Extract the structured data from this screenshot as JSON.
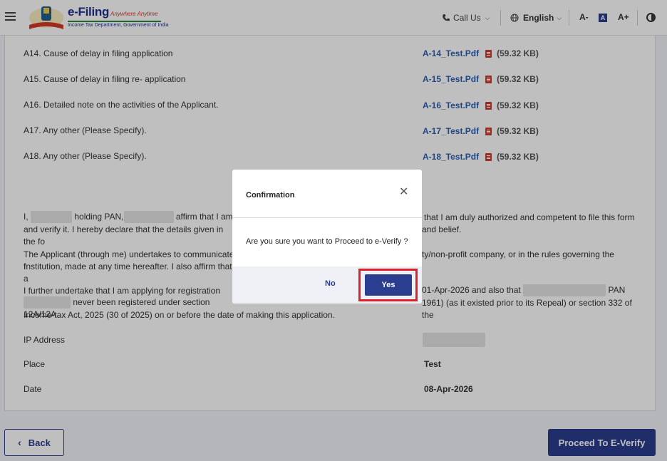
{
  "header": {
    "logo_title": "e-Filing",
    "logo_tagline": "Anywhere Anytime",
    "logo_subtitle": "Income Tax Department, Government of India",
    "call_us": "Call Us",
    "language": "English",
    "font_decrease": "A-",
    "font_normal": "A",
    "font_increase": "A+"
  },
  "documents": [
    {
      "label": "A14. Cause of delay in filing application",
      "file": "A-14_Test.Pdf",
      "size": "(59.32 KB)"
    },
    {
      "label": "A15. Cause of delay in filing re- application",
      "file": "A-15_Test.Pdf",
      "size": "(59.32 KB)"
    },
    {
      "label": "A16. Detailed note on the activities of the Applicant.",
      "file": "A-16_Test.Pdf",
      "size": "(59.32 KB)"
    },
    {
      "label": "A17. Any other (Please Specify).",
      "file": "A-17_Test.Pdf",
      "size": "(59.32 KB)"
    },
    {
      "label": "A18. Any other (Please Specify).",
      "file": "A-18_Test.Pdf",
      "size": "(59.32 KB)"
    }
  ],
  "declaration": {
    "p1_a": "I,",
    "p1_b": "holding PAN,",
    "p1_c": "affirm that I am",
    "p1_d": "that I am duly authorized and competent to file this form",
    "p1_e": "and verify it. I hereby declare that the details given in the fo",
    "p1_f": "and belief.",
    "p2_a": "The Applicant (through me) undertakes to communicate f",
    "p2_b": "ty/non-profit company, or in the rules governing the",
    "p2_c": "Institution, made at any time hereafter. I also affirm that I a",
    "p3_a": "I further undertake that I am applying for registration unde",
    "p3_b": "01-Apr-2026 and also that",
    "p3_c": "PAN",
    "p3_d": "never been registered under section 12A/12A",
    "p3_e": "1961) (as it existed prior to its Repeal) or section 332 of the",
    "p3_f": "Income-tax Act, 2025 (30 of 2025) on or before the date of making this application."
  },
  "details": {
    "ip_label": "IP Address",
    "place_label": "Place",
    "place_value": "Test",
    "date_label": "Date",
    "date_value": "08-Apr-2026"
  },
  "footer": {
    "back_label": "Back",
    "proceed_label": "Proceed To E-Verify"
  },
  "modal": {
    "title": "Confirmation",
    "message": "Are you sure you want to Proceed to e-Verify ?",
    "no_label": "No",
    "yes_label": "Yes"
  }
}
